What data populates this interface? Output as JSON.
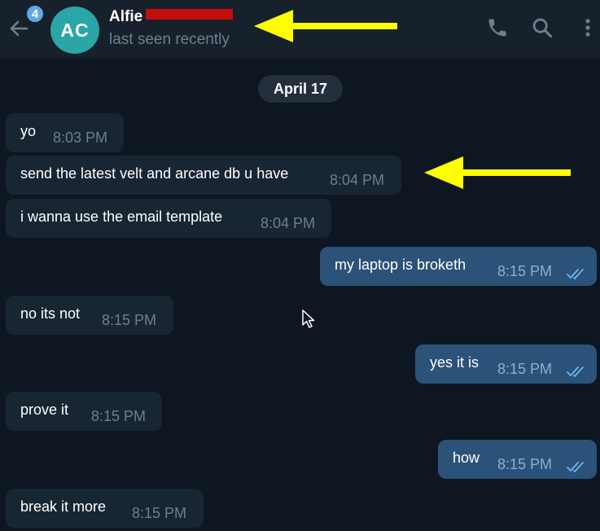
{
  "header": {
    "unread_count": "4",
    "avatar_initials": "AC",
    "contact_name": "Alfie",
    "status": "last seen recently"
  },
  "chat": {
    "date_label": "April 17",
    "messages": [
      {
        "direction": "in",
        "text": "yo",
        "time": "8:03 PM"
      },
      {
        "direction": "in",
        "text": "send the latest velt and arcane db u have",
        "time": "8:04 PM"
      },
      {
        "direction": "in",
        "text": "i wanna use the email template",
        "time": "8:04 PM"
      },
      {
        "direction": "out",
        "text": "my laptop is broketh",
        "time": "8:15 PM",
        "read": true
      },
      {
        "direction": "in",
        "text": "no its not",
        "time": "8:15 PM"
      },
      {
        "direction": "out",
        "text": "yes it is",
        "time": "8:15 PM",
        "read": true
      },
      {
        "direction": "in",
        "text": "prove it",
        "time": "8:15 PM"
      },
      {
        "direction": "out",
        "text": "how",
        "time": "8:15 PM",
        "read": true
      },
      {
        "direction": "in",
        "text": "break it more",
        "time": "8:15 PM"
      }
    ]
  },
  "icons": {
    "back": "arrow-left-icon",
    "call": "phone-icon",
    "search": "search-icon",
    "menu": "more-vertical-icon",
    "read_receipt": "double-check-icon"
  },
  "colors": {
    "background": "#0e1621",
    "header": "#17212b",
    "incoming_bubble": "#182533",
    "outgoing_bubble": "#2b5278",
    "avatar": "#2aa6a6",
    "badge": "#5fa8e8",
    "annotation_arrow": "#ffff00",
    "redaction": "#c40e0e"
  }
}
